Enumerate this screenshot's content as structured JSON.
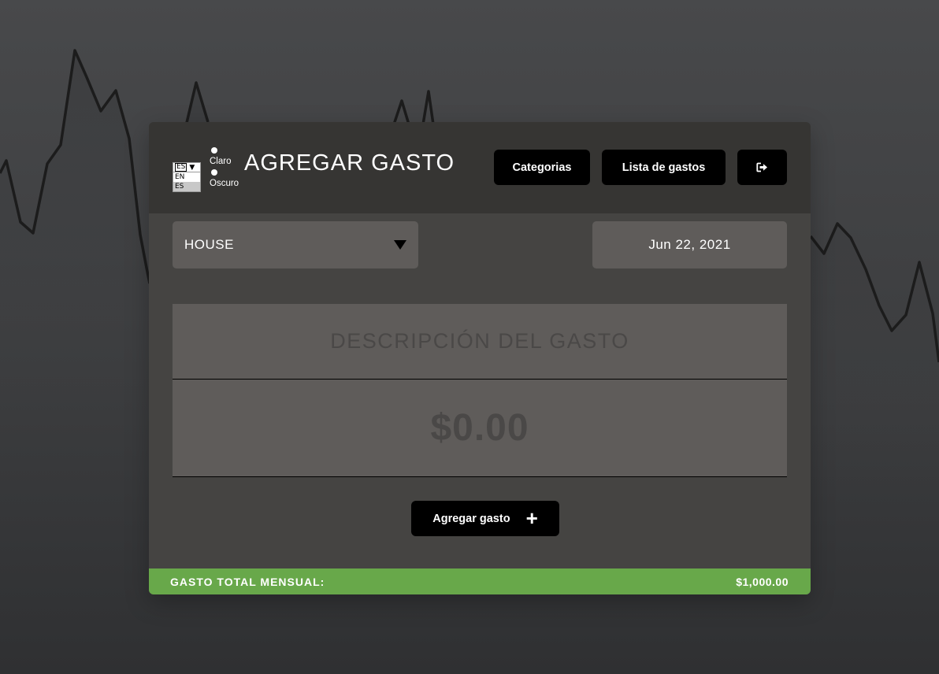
{
  "language": {
    "selected": "ES",
    "options": [
      "EN",
      "ES"
    ]
  },
  "theme": {
    "options": [
      "Claro",
      "Oscuro"
    ]
  },
  "header": {
    "title": "AGREGAR GASTO",
    "categories_label": "Categorias",
    "list_label": "Lista de gastos",
    "logout_icon": "sign-out-icon"
  },
  "form": {
    "category_value": "HOUSE",
    "date_value": "Jun 22, 2021",
    "description_placeholder": "DESCRIPCIÓN DEL GASTO",
    "amount_placeholder": "$0.00",
    "add_label": "Agregar gasto",
    "add_icon": "plus-icon"
  },
  "footer": {
    "label": "GASTO TOTAL MENSUAL:",
    "value": "$1,000.00"
  },
  "colors": {
    "background": "#48494b",
    "card": "#454442",
    "header": "#363533",
    "field": "#5f5c5a",
    "button": "#000000",
    "accent_green": "#68a84a"
  }
}
